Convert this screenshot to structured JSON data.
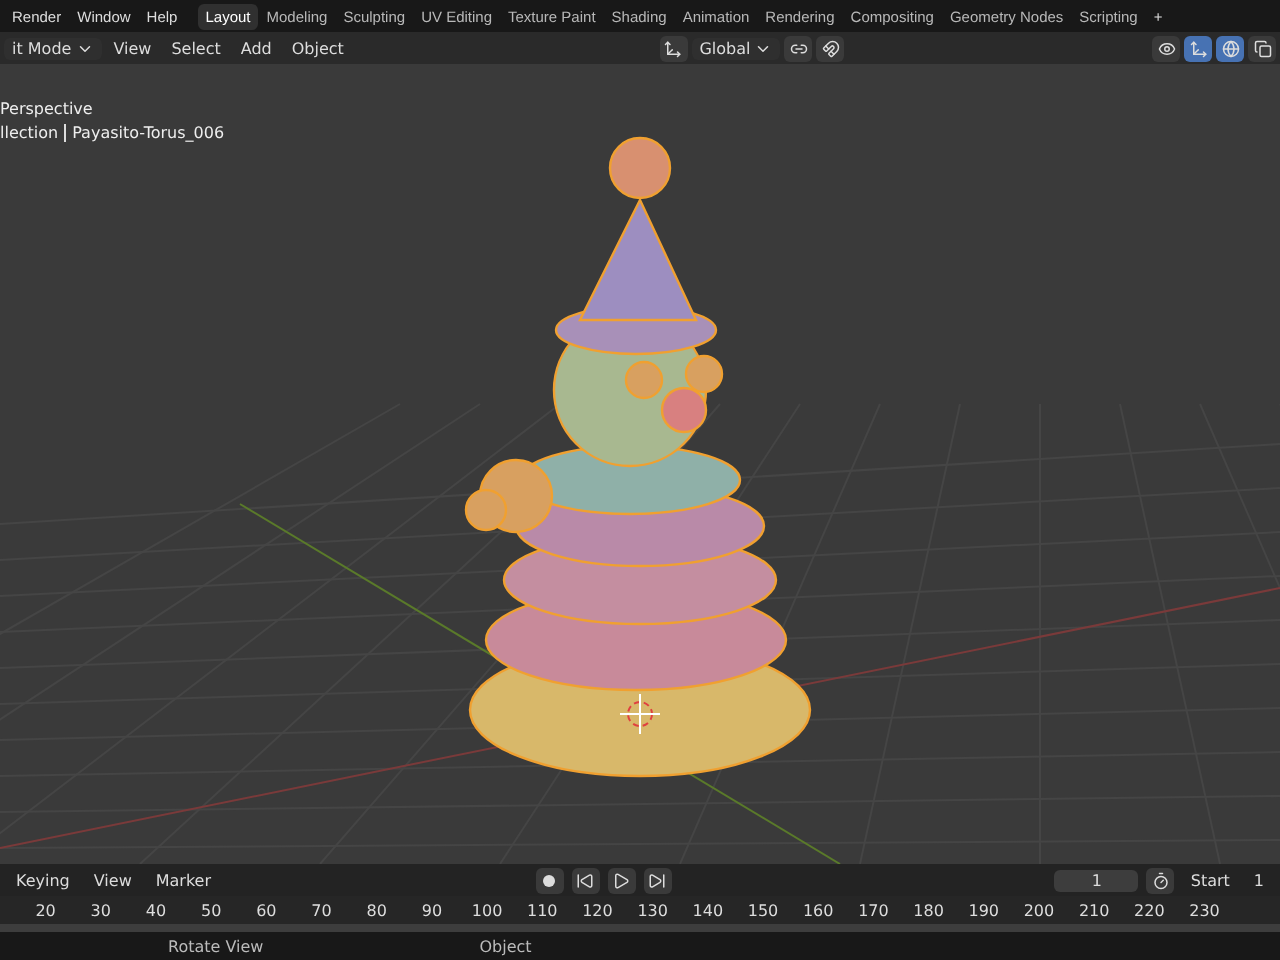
{
  "top_bar": {
    "menus": [
      "Render",
      "Window",
      "Help"
    ],
    "workspaces": [
      {
        "label": "Layout",
        "selected": true
      },
      {
        "label": "Modeling",
        "selected": false
      },
      {
        "label": "Sculpting",
        "selected": false
      },
      {
        "label": "UV Editing",
        "selected": false
      },
      {
        "label": "Texture Paint",
        "selected": false
      },
      {
        "label": "Shading",
        "selected": false
      },
      {
        "label": "Animation",
        "selected": false
      },
      {
        "label": "Rendering",
        "selected": false
      },
      {
        "label": "Compositing",
        "selected": false
      },
      {
        "label": "Geometry Nodes",
        "selected": false
      },
      {
        "label": "Scripting",
        "selected": false
      }
    ],
    "add_tab": "+"
  },
  "viewport_header": {
    "mode": "it Mode",
    "menus": [
      "View",
      "Select",
      "Add",
      "Object"
    ],
    "orientation": "Global"
  },
  "viewport": {
    "view_name": "Perspective",
    "collection": "llection",
    "object": "Payasito-Torus_006"
  },
  "timeline": {
    "menus": [
      "Keying",
      "View",
      "Marker"
    ],
    "current_frame": "1",
    "start_label": "Start",
    "start_value": "1",
    "ticks": [
      "20",
      "30",
      "40",
      "50",
      "60",
      "70",
      "80",
      "90",
      "100",
      "110",
      "120",
      "130",
      "140",
      "150",
      "160",
      "170",
      "180",
      "190",
      "200",
      "210",
      "220",
      "230"
    ]
  },
  "status_bar": {
    "hints": [
      "Rotate View",
      "Object"
    ]
  }
}
